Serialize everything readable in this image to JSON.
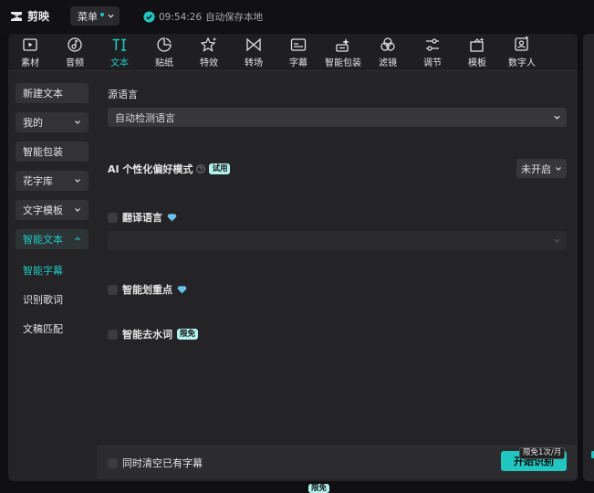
{
  "app": {
    "name": "剪映",
    "menu_label": "菜单"
  },
  "save_status": {
    "time": "09:54:26",
    "text": "自动保存本地"
  },
  "colors": {
    "accent": "#21c6c1",
    "panel": "#242426",
    "badge": "#b3f3ef"
  },
  "toolbar": [
    {
      "label": "素材",
      "icon": "media-icon"
    },
    {
      "label": "音频",
      "icon": "audio-icon"
    },
    {
      "label": "文本",
      "icon": "text-icon",
      "active": true
    },
    {
      "label": "贴纸",
      "icon": "sticker-icon"
    },
    {
      "label": "特效",
      "icon": "effects-icon"
    },
    {
      "label": "转场",
      "icon": "transition-icon"
    },
    {
      "label": "字幕",
      "icon": "subtitle-icon"
    },
    {
      "label": "智能包装",
      "icon": "smart-package-icon"
    },
    {
      "label": "滤镜",
      "icon": "filter-icon"
    },
    {
      "label": "调节",
      "icon": "adjust-icon"
    },
    {
      "label": "模板",
      "icon": "template-icon"
    },
    {
      "label": "数字人",
      "icon": "digital-human-icon"
    }
  ],
  "sidebar": {
    "items": [
      {
        "label": "新建文本"
      },
      {
        "label": "我的"
      },
      {
        "label": "智能包装"
      },
      {
        "label": "花字库"
      },
      {
        "label": "文字模板"
      },
      {
        "label": "智能文本"
      }
    ],
    "sub_items": [
      {
        "label": "智能字幕",
        "active": true
      },
      {
        "label": "识别歌词"
      },
      {
        "label": "文稿匹配"
      }
    ]
  },
  "content": {
    "source_language_label": "源语言",
    "source_language_value": "自动检测语言",
    "ai_mode_label": "AI 个性化偏好模式",
    "ai_mode_badge": "试用",
    "ai_mode_value": "未开启",
    "translate_label": "翻译语言",
    "highlight_label": "智能划重点",
    "remove_filler_label": "智能去水词",
    "remove_filler_badge": "限免"
  },
  "bottom": {
    "clear_label": "同时清空已有字幕",
    "start_label": "开始识别",
    "limit_badge": "限免1次/月",
    "edge_badge": "限免"
  }
}
